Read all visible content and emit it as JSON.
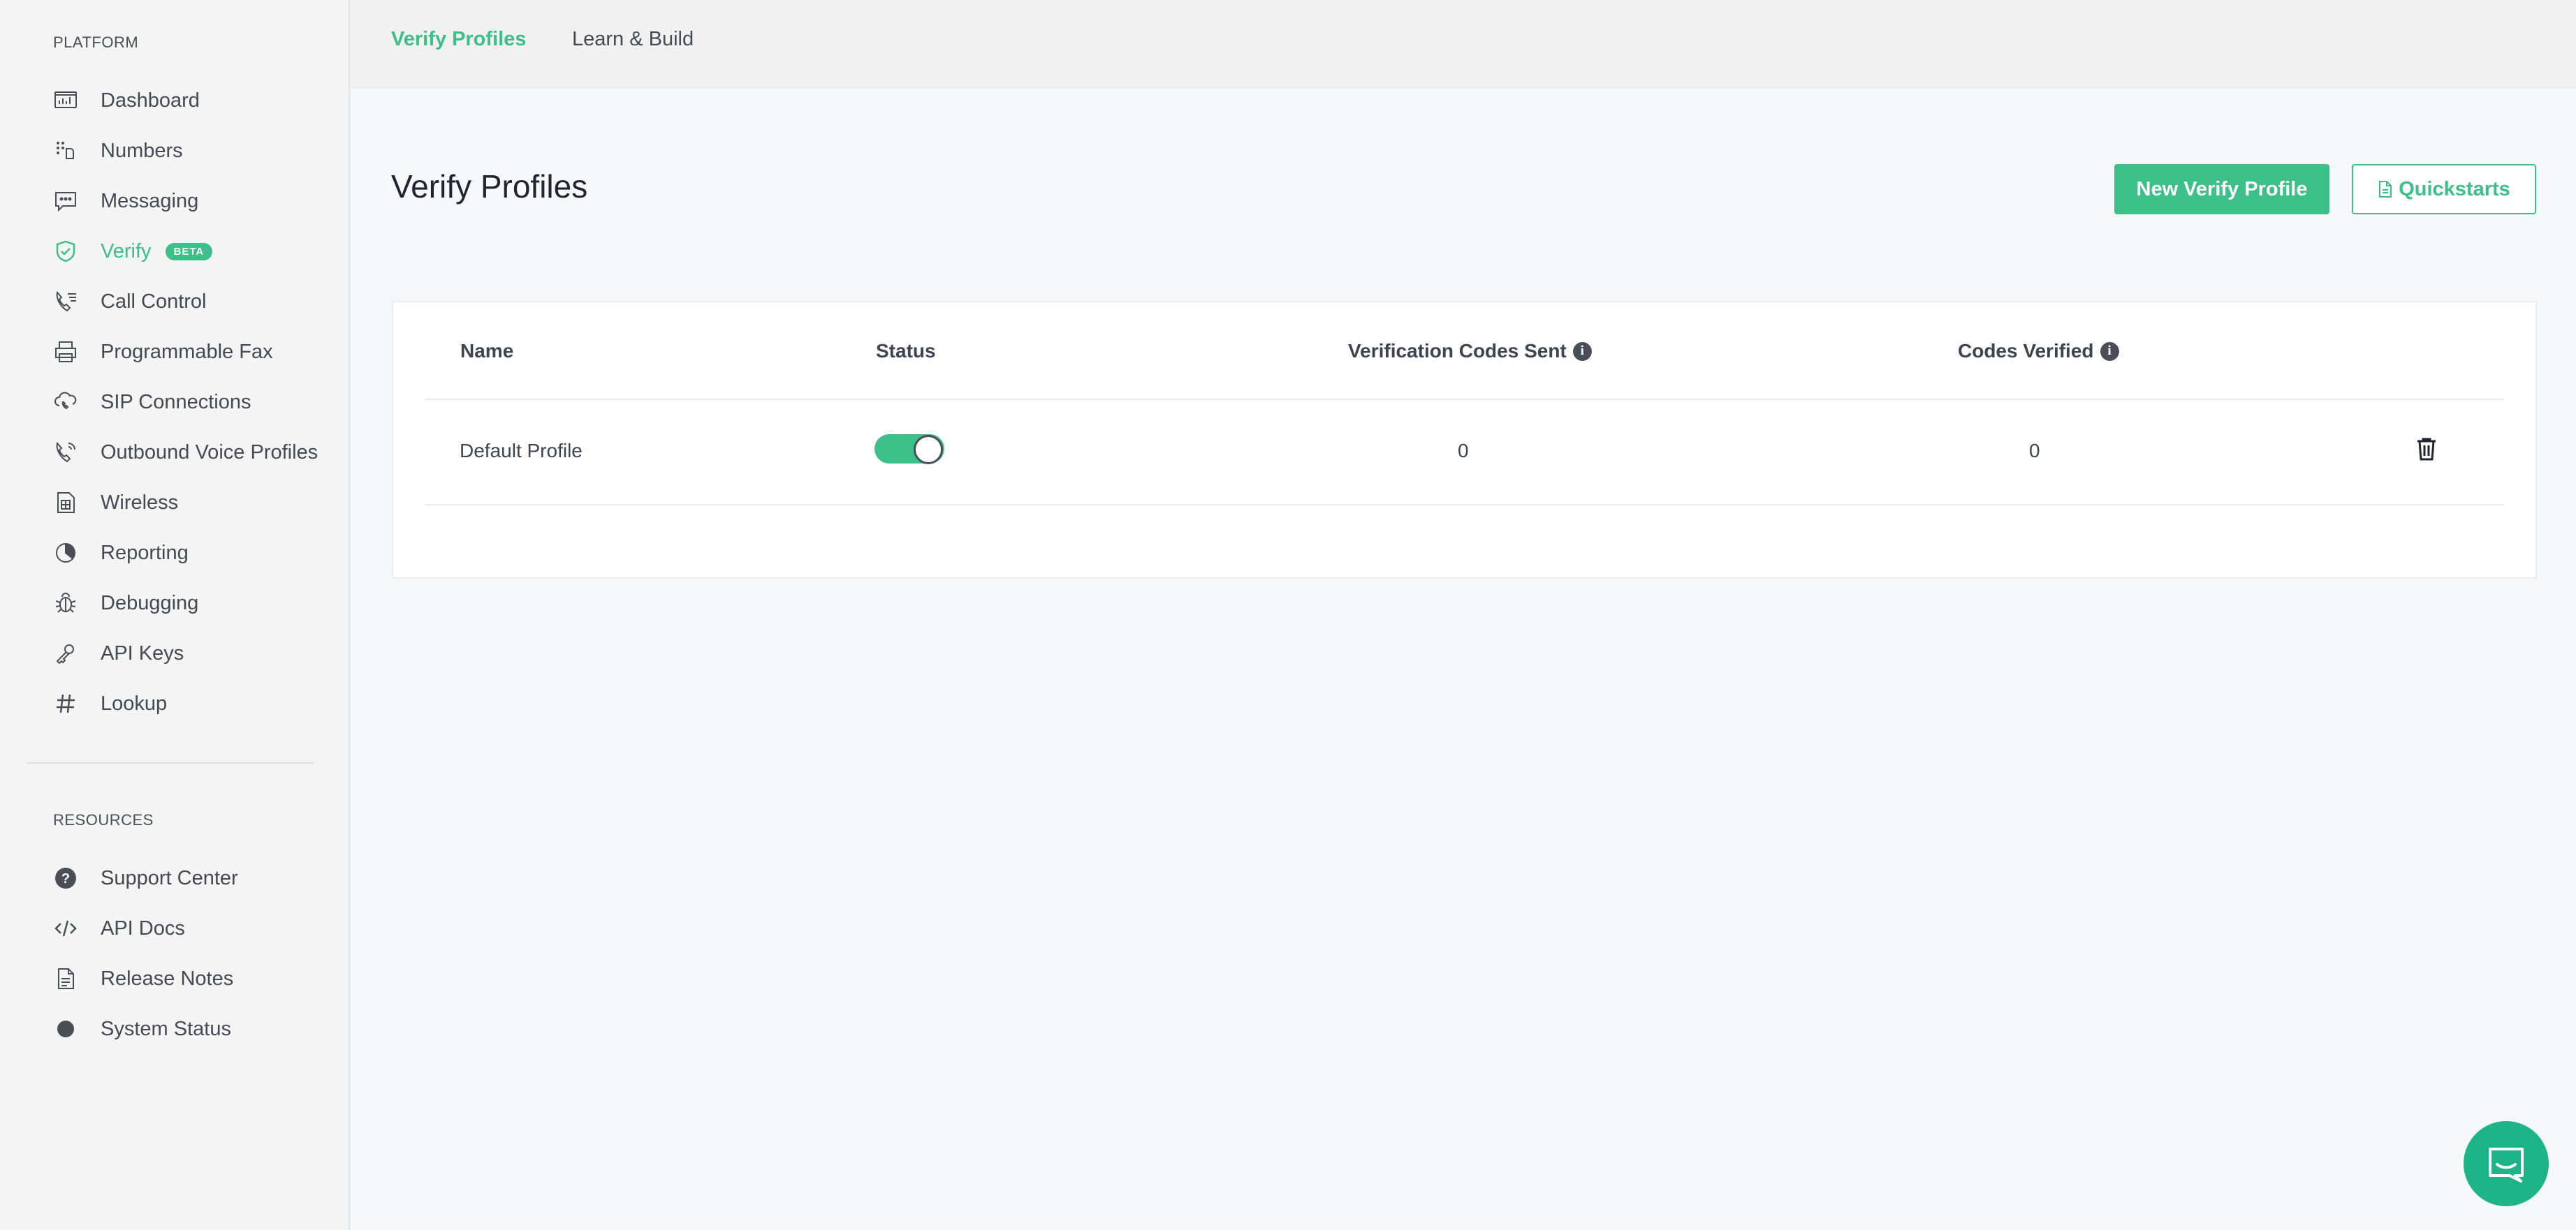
{
  "sidebar": {
    "platform_title": "PLATFORM",
    "resources_title": "RESOURCES",
    "beta_badge": "BETA",
    "platform_items": [
      {
        "label": "Dashboard"
      },
      {
        "label": "Numbers"
      },
      {
        "label": "Messaging"
      },
      {
        "label": "Verify"
      },
      {
        "label": "Call Control"
      },
      {
        "label": "Programmable Fax"
      },
      {
        "label": "SIP Connections"
      },
      {
        "label": "Outbound Voice Profiles"
      },
      {
        "label": "Wireless"
      },
      {
        "label": "Reporting"
      },
      {
        "label": "Debugging"
      },
      {
        "label": "API Keys"
      },
      {
        "label": "Lookup"
      }
    ],
    "resource_items": [
      {
        "label": "Support Center"
      },
      {
        "label": "API Docs"
      },
      {
        "label": "Release Notes"
      },
      {
        "label": "System Status"
      }
    ]
  },
  "topbar": {
    "tabs": [
      {
        "label": "Verify Profiles"
      },
      {
        "label": "Learn & Build"
      }
    ]
  },
  "main": {
    "title": "Verify Profiles",
    "new_button": "New Verify Profile",
    "quickstarts_button": "Quickstarts",
    "table": {
      "headers": [
        "Name",
        "Status",
        "Verification Codes Sent",
        "Codes Verified"
      ],
      "rows": [
        {
          "name": "Default Profile",
          "status_enabled": true,
          "codes_sent": "0",
          "codes_verified": "0"
        }
      ]
    }
  },
  "colors": {
    "accent": "#3cbf88",
    "sidebar_bg": "#f4f4f4",
    "page_bg": "#f7f8f9",
    "chat": "#1db588"
  },
  "icons": {
    "dashboard": "dashboard-icon",
    "numbers": "dialpad-icon",
    "messaging": "chat-icon",
    "verify": "shield-check-icon",
    "call_control": "phone-list-icon",
    "fax": "printer-icon",
    "sip": "cloud-phone-icon",
    "outbound": "phone-outgoing-icon",
    "wireless": "sim-card-icon",
    "reporting": "pie-chart-icon",
    "debugging": "bug-icon",
    "api_keys": "key-icon",
    "lookup": "hashtag-icon",
    "support": "question-circle-icon",
    "api_docs": "code-icon",
    "release_notes": "document-icon",
    "system_status": "status-dot-icon"
  }
}
